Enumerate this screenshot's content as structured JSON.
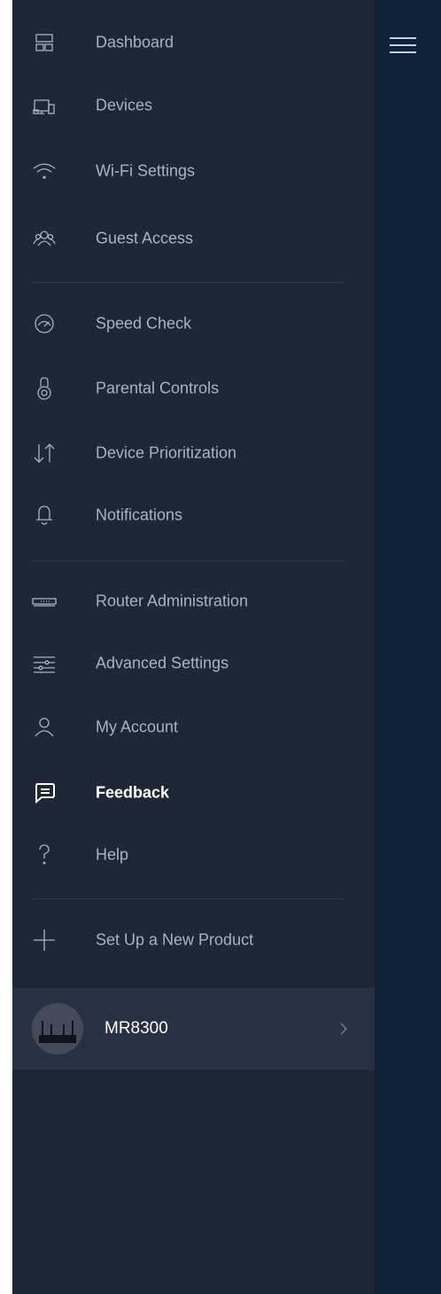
{
  "menu": {
    "group1": [
      {
        "label": "Dashboard",
        "icon": "dashboard-icon"
      },
      {
        "label": "Devices",
        "icon": "devices-icon"
      },
      {
        "label": "Wi-Fi Settings",
        "icon": "wifi-icon"
      },
      {
        "label": "Guest Access",
        "icon": "guest-access-icon"
      }
    ],
    "group2": [
      {
        "label": "Speed Check",
        "icon": "speedometer-icon"
      },
      {
        "label": "Parental Controls",
        "icon": "parental-lock-icon"
      },
      {
        "label": "Device Prioritization",
        "icon": "priority-arrows-icon"
      },
      {
        "label": "Notifications",
        "icon": "bell-icon"
      }
    ],
    "group3": [
      {
        "label": "Router Administration",
        "icon": "router-icon"
      },
      {
        "label": "Advanced Settings",
        "icon": "sliders-icon"
      },
      {
        "label": "My Account",
        "icon": "user-icon"
      },
      {
        "label": "Feedback",
        "icon": "feedback-icon",
        "active": true
      },
      {
        "label": "Help",
        "icon": "question-mark-icon"
      }
    ],
    "group4": [
      {
        "label": "Set Up a New Product",
        "icon": "plus-icon"
      }
    ]
  },
  "router": {
    "name": "MR8300",
    "icon": "chevron-right-icon"
  },
  "colors": {
    "panel_bg": "#1e2638",
    "right_pane_bg": "#0d2236",
    "router_row_bg": "#283044",
    "label_color": "#aab4c0",
    "active_label_color": "#ffffff"
  }
}
